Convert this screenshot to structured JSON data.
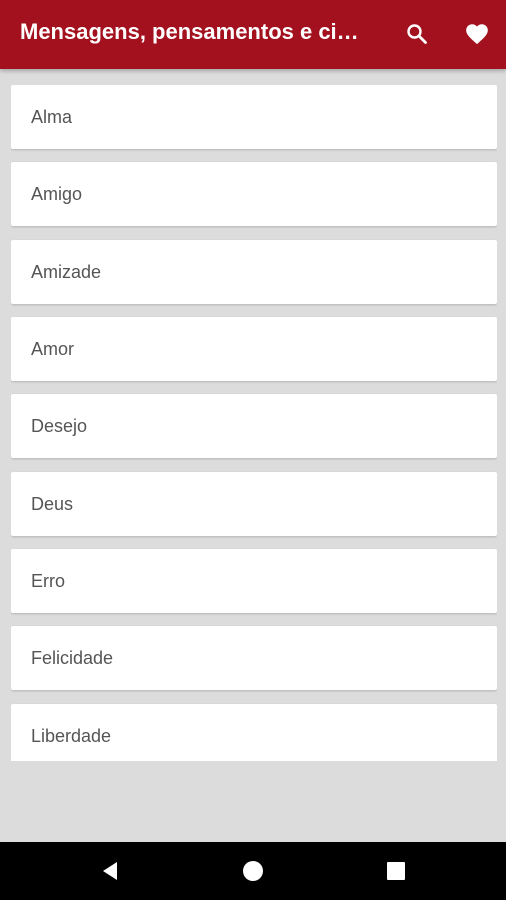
{
  "app_bar": {
    "title": "Mensagens, pensamentos e ci…",
    "background_color": "#a3111e",
    "actions": [
      {
        "icon": "search-icon"
      },
      {
        "icon": "heart-icon"
      }
    ]
  },
  "categories": [
    {
      "label": "Alma"
    },
    {
      "label": "Amigo"
    },
    {
      "label": "Amizade"
    },
    {
      "label": "Amor"
    },
    {
      "label": "Desejo"
    },
    {
      "label": "Deus"
    },
    {
      "label": "Erro"
    },
    {
      "label": "Felicidade"
    },
    {
      "label": "Liberdade"
    }
  ],
  "nav_bar": {
    "buttons": [
      {
        "icon": "back-triangle-icon"
      },
      {
        "icon": "home-circle-icon"
      },
      {
        "icon": "recents-square-icon"
      }
    ]
  }
}
